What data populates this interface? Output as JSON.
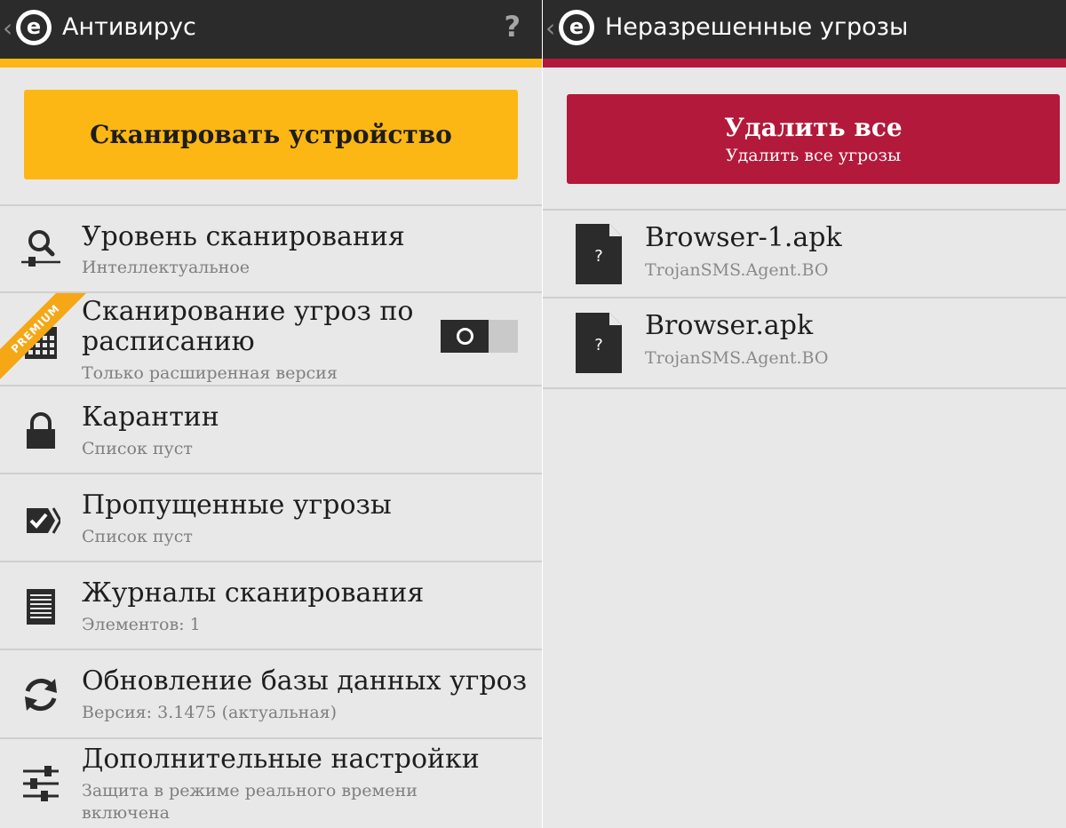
{
  "colors": {
    "actionbar": "#2b2b2b",
    "accent_antivirus": "#fdb714",
    "accent_threats": "#b3193a",
    "background": "#e8e8e8"
  },
  "left_panel": {
    "title": "Антивирус",
    "help": "?",
    "scan_button": "Сканировать устройство",
    "premium_badge": "PREMIUM",
    "items": [
      {
        "title": "Уровень сканирования",
        "subtitle": "Интеллектуальное",
        "icon": "scan-level-icon"
      },
      {
        "title": "Сканирование угроз по расписанию",
        "subtitle": "Только расширенная версия",
        "icon": "calendar-icon",
        "toggle": "off"
      },
      {
        "title": "Карантин",
        "subtitle": "Список пуст",
        "icon": "lock-icon"
      },
      {
        "title": "Пропущенные угрозы",
        "subtitle": "Список пуст",
        "icon": "ignored-threat-icon"
      },
      {
        "title": "Журналы сканирования",
        "subtitle": "Элементов: 1",
        "icon": "log-icon"
      },
      {
        "title": "Обновление базы данных угроз",
        "subtitle": "Версия: 3.1475 (актуальная)",
        "icon": "refresh-icon"
      },
      {
        "title": "Дополнительные настройки",
        "subtitle": "Защита в режиме реального времени включена",
        "icon": "settings-sliders-icon"
      }
    ]
  },
  "right_panel": {
    "title": "Неразрешенные угрозы",
    "delete_all": {
      "label": "Удалить все",
      "sublabel": "Удалить все угрозы"
    },
    "files": [
      {
        "name": "Browser-1.apk",
        "threat": "TrojanSMS.Agent.BO",
        "icon": "unknown-file-icon"
      },
      {
        "name": "Browser.apk",
        "threat": "TrojanSMS.Agent.BO",
        "icon": "unknown-file-icon"
      }
    ],
    "file_icon_glyph": "?"
  }
}
